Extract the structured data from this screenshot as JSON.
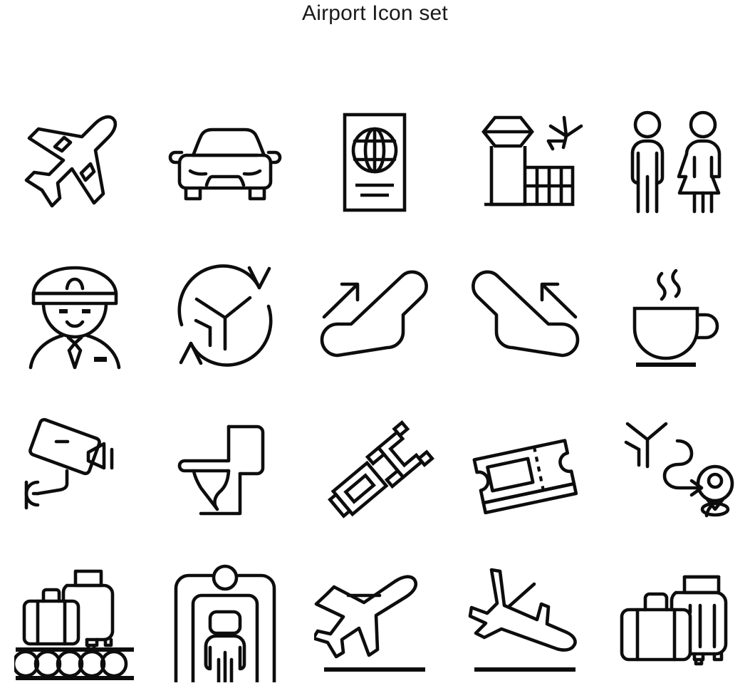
{
  "page": {
    "title": "Airport Icon set",
    "background_color": "#ffffff",
    "stroke_color": "#0d0d0d",
    "columns": 5,
    "rows": 4,
    "icon_count": 20,
    "style": "thin line / outline"
  },
  "icons": [
    {
      "index": 1,
      "name": "airplane-diagonal-icon",
      "label": "Airplane",
      "row": 1,
      "column": 1
    },
    {
      "index": 2,
      "name": "car-front-icon",
      "label": "Car rental",
      "row": 1,
      "column": 2
    },
    {
      "index": 3,
      "name": "passport-globe-icon",
      "label": "Passport",
      "row": 1,
      "column": 3
    },
    {
      "index": 4,
      "name": "airport-terminal-icon",
      "label": "Airport terminal",
      "row": 1,
      "column": 4
    },
    {
      "index": 5,
      "name": "restroom-man-woman-icon",
      "label": "Restrooms",
      "row": 1,
      "column": 5
    },
    {
      "index": 6,
      "name": "pilot-captain-icon",
      "label": "Pilot",
      "row": 2,
      "column": 1
    },
    {
      "index": 7,
      "name": "flight-transfer-clock-icon",
      "label": "Flight transfer",
      "row": 2,
      "column": 2
    },
    {
      "index": 8,
      "name": "escalator-up-icon",
      "label": "Escalator up",
      "row": 2,
      "column": 3
    },
    {
      "index": 9,
      "name": "escalator-down-icon",
      "label": "Escalator down",
      "row": 2,
      "column": 4
    },
    {
      "index": 10,
      "name": "coffee-cup-icon",
      "label": "Cafe",
      "row": 2,
      "column": 5
    },
    {
      "index": 11,
      "name": "cctv-camera-icon",
      "label": "Security camera",
      "row": 3,
      "column": 1
    },
    {
      "index": 12,
      "name": "toilet-icon",
      "label": "Toilet",
      "row": 3,
      "column": 2
    },
    {
      "index": 13,
      "name": "seatbelt-buckle-icon",
      "label": "Seatbelt",
      "row": 3,
      "column": 3
    },
    {
      "index": 14,
      "name": "boarding-tickets-icon",
      "label": "Tickets",
      "row": 3,
      "column": 4
    },
    {
      "index": 15,
      "name": "flight-route-pin-icon",
      "label": "Flight route",
      "row": 3,
      "column": 5
    },
    {
      "index": 16,
      "name": "baggage-claim-belt-icon",
      "label": "Baggage claim",
      "row": 4,
      "column": 1
    },
    {
      "index": 17,
      "name": "security-scanner-gate-icon",
      "label": "Security check",
      "row": 4,
      "column": 2
    },
    {
      "index": 18,
      "name": "departure-plane-icon",
      "label": "Departure",
      "row": 4,
      "column": 3
    },
    {
      "index": 19,
      "name": "arrival-plane-icon",
      "label": "Arrival",
      "row": 4,
      "column": 4
    },
    {
      "index": 20,
      "name": "luggage-suitcases-icon",
      "label": "Luggage",
      "row": 4,
      "column": 5
    }
  ]
}
